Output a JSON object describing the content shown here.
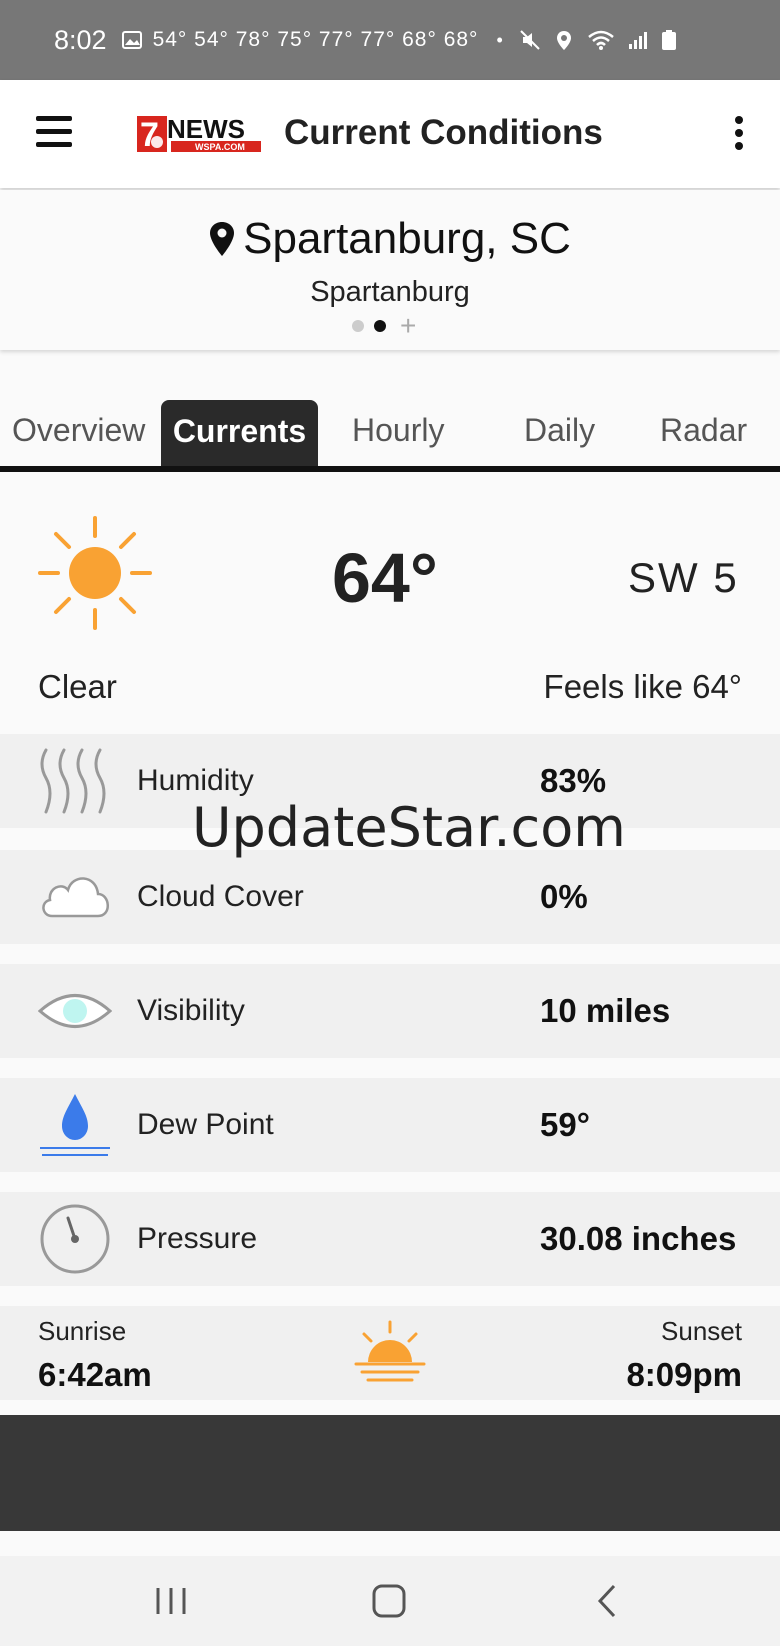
{
  "status_bar": {
    "time": "8:02",
    "temps": "54° 54° 78° 75° 77° 77° 68° 68°",
    "dot": "•"
  },
  "app_bar": {
    "title": "Current Conditions",
    "logo_text": "7NEWS",
    "logo_sub": "WSPA.COM"
  },
  "location": {
    "name": "Spartanburg, SC",
    "subtitle": "Spartanburg",
    "page_plus": "+"
  },
  "tabs": [
    {
      "label": "Overview"
    },
    {
      "label": "Currents"
    },
    {
      "label": "Hourly"
    },
    {
      "label": "Daily"
    },
    {
      "label": "Radar"
    }
  ],
  "current": {
    "temperature": "64°",
    "wind": "SW  5",
    "condition": "Clear",
    "feels_like": "Feels like 64°"
  },
  "details": [
    {
      "label": "Humidity",
      "value": "83%"
    },
    {
      "label": "Cloud Cover",
      "value": "0%"
    },
    {
      "label": "Visibility",
      "value": "10 miles"
    },
    {
      "label": "Dew Point",
      "value": "59°"
    },
    {
      "label": "Pressure",
      "value": "30.08 inches"
    }
  ],
  "sun": {
    "sunrise_label": "Sunrise",
    "sunrise_time": "6:42am",
    "sunset_label": "Sunset",
    "sunset_time": "8:09pm"
  },
  "watermark": "UpdateStar.com",
  "colors": {
    "sun": "#f9a233",
    "drop": "#3b7bea",
    "eye": "#bff5f0"
  }
}
